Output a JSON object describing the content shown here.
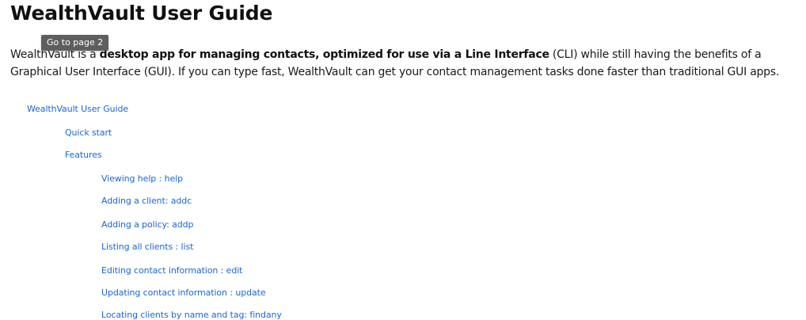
{
  "document": {
    "title": "WealthVault User Guide",
    "intro": {
      "seg1": "WealthVault is a ",
      "bold1": "desktop app for managing contacts, optimized for use via a Line Interface",
      "seg2": " (CLI) while still having the benefits of a Graphical User Interface (GUI). If you can type fast, WealthVault can get your contact management tasks done faster than traditional GUI apps."
    }
  },
  "tooltip": {
    "text": "Go to page 2"
  },
  "toc": {
    "items": [
      {
        "label": "WealthVault User Guide",
        "level": 1
      },
      {
        "label": "Quick start",
        "level": 2
      },
      {
        "label": "Features",
        "level": 2
      },
      {
        "label": "Viewing help : help",
        "level": 3
      },
      {
        "label": "Adding a client: addc",
        "level": 3
      },
      {
        "label": "Adding a policy: addp",
        "level": 3
      },
      {
        "label": "Listing all clients : list",
        "level": 3
      },
      {
        "label": "Editing contact information : edit",
        "level": 3
      },
      {
        "label": "Updating contact information : update",
        "level": 3
      },
      {
        "label": "Locating clients by name and tag: findany",
        "level": 3
      }
    ]
  },
  "colors": {
    "link": "#1a66d6",
    "tooltip_bg": "#5e5e5e",
    "text": "#1a1a1a"
  }
}
